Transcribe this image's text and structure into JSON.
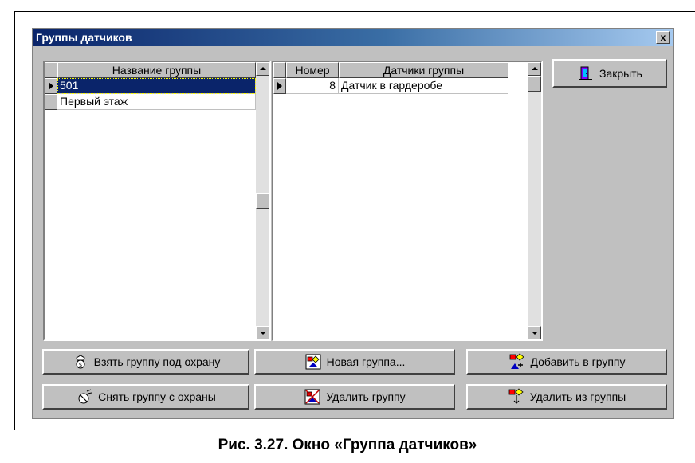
{
  "window": {
    "title": "Группы датчиков",
    "close_glyph": "x"
  },
  "groups_grid": {
    "header": "Название группы",
    "rows": [
      "501",
      "Первый этаж"
    ],
    "selected_index": 0
  },
  "sensors_grid": {
    "headers": {
      "number": "Номер",
      "sensors": "Датчики группы"
    },
    "rows": [
      {
        "number": "8",
        "name": "Датчик в гардеробе"
      }
    ]
  },
  "buttons": {
    "close": "Закрыть",
    "arm_group": "Взять группу под охрану",
    "new_group": "Новая группа...",
    "add_to_group": "Добавить в группу",
    "disarm_group": "Снять группу с охраны",
    "delete_group": "Удалить группу",
    "remove_from_group": "Удалить из группы"
  },
  "icons": {
    "close": "door-exit-icon",
    "arm_group": "guard-icon",
    "new_group": "new-group-icon",
    "add_to_group": "add-to-group-icon",
    "disarm_group": "disarm-icon",
    "delete_group": "delete-group-icon",
    "remove_from_group": "remove-from-group-icon"
  },
  "colors": {
    "title_bar": "#0a246a",
    "selection": "#0a246a",
    "window_face": "#c0c0c0"
  },
  "caption": "Рис. 3.27. Окно «Группа датчиков»"
}
